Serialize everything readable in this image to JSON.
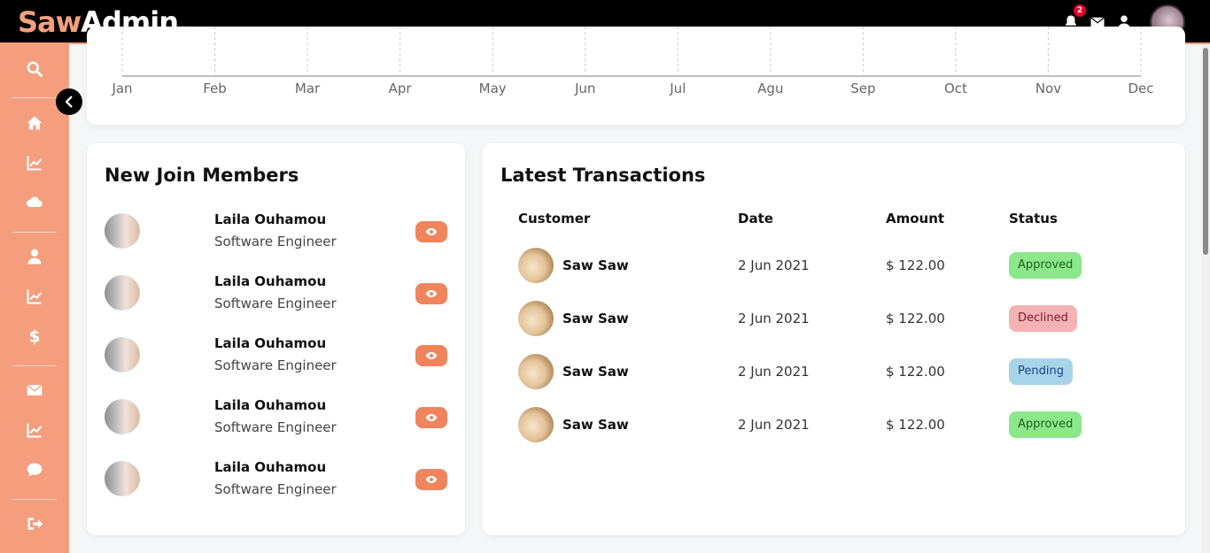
{
  "brand": {
    "part1": "Saw",
    "part2": "Admin."
  },
  "header": {
    "notification_count": "2",
    "icons": [
      "bell-icon",
      "envelope-icon",
      "user-icon"
    ]
  },
  "sidebar": {
    "items": [
      "search-icon",
      "home-icon",
      "chart-icon",
      "cloud-icon",
      "user-icon",
      "chart-icon",
      "dollar-icon",
      "envelope-icon",
      "chart-icon",
      "chat-icon",
      "logout-icon"
    ]
  },
  "chart": {
    "months": [
      "Jan",
      "Feb",
      "Mar",
      "Apr",
      "May",
      "Jun",
      "Jul",
      "Agu",
      "Sep",
      "Oct",
      "Nov",
      "Dec"
    ]
  },
  "members": {
    "title": "New Join Members",
    "items": [
      {
        "name": "Laila Ouhamou",
        "role": "Software Engineer"
      },
      {
        "name": "Laila Ouhamou",
        "role": "Software Engineer"
      },
      {
        "name": "Laila Ouhamou",
        "role": "Software Engineer"
      },
      {
        "name": "Laila Ouhamou",
        "role": "Software Engineer"
      },
      {
        "name": "Laila Ouhamou",
        "role": "Software Engineer"
      }
    ]
  },
  "transactions": {
    "title": "Latest Transactions",
    "columns": [
      "Customer",
      "Date",
      "Amount",
      "Status"
    ],
    "rows": [
      {
        "customer": "Saw Saw",
        "date": "2 Jun 2021",
        "amount": "$ 122.00",
        "status": "Approved"
      },
      {
        "customer": "Saw Saw",
        "date": "2 Jun 2021",
        "amount": "$ 122.00",
        "status": "Declined"
      },
      {
        "customer": "Saw Saw",
        "date": "2 Jun 2021",
        "amount": "$ 122.00",
        "status": "Pending"
      },
      {
        "customer": "Saw Saw",
        "date": "2 Jun 2021",
        "amount": "$ 122.00",
        "status": "Approved"
      }
    ]
  },
  "colors": {
    "accent": "#f49e7e",
    "button": "#f0845c",
    "approved_bg": "#8ce78a",
    "approved_fg": "#1c5e1c",
    "declined_bg": "#f5b2b4",
    "declined_fg": "#7a1f24",
    "pending_bg": "#a8d4ea",
    "pending_fg": "#1f3f86"
  }
}
